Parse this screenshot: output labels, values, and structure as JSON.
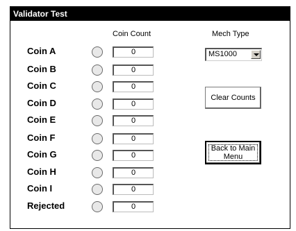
{
  "window": {
    "title": "Validator Test"
  },
  "headers": {
    "coin_count": "Coin Count",
    "mech_type": "Mech Type"
  },
  "rows": [
    {
      "label": "Coin A",
      "count": "0"
    },
    {
      "label": "Coin B",
      "count": "0"
    },
    {
      "label": "Coin C",
      "count": "0"
    },
    {
      "label": "Coin D",
      "count": "0"
    },
    {
      "label": "Coin E",
      "count": "0"
    },
    {
      "label": "Coin F",
      "count": "0"
    },
    {
      "label": "Coin G",
      "count": "0"
    },
    {
      "label": "Coin H",
      "count": "0"
    },
    {
      "label": "Coin I",
      "count": "0"
    },
    {
      "label": "Rejected",
      "count": "0"
    }
  ],
  "mech_select": {
    "value": "MS1000"
  },
  "buttons": {
    "clear": "Clear Counts",
    "back_line1": "Back to Main",
    "back_line2": "Menu"
  }
}
